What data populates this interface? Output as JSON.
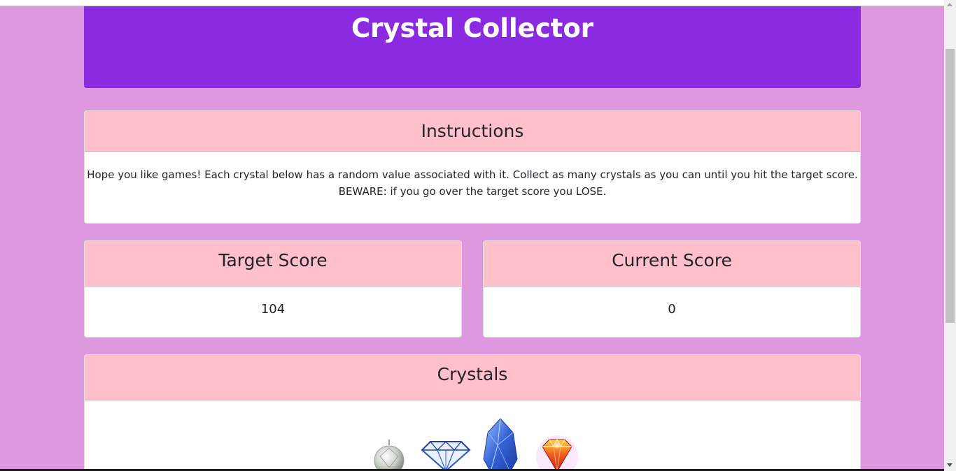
{
  "header": {
    "title": "Crystal Collector"
  },
  "instructions": {
    "title": "Instructions",
    "line1": "Hope you like games! Each crystal below has a random value associated with it. Collect as many crystals as you can until you hit the target score.",
    "line2": "BEWARE: if you go over the target score you LOSE."
  },
  "target": {
    "title": "Target Score",
    "value": "104"
  },
  "current": {
    "title": "Current Score",
    "value": "0"
  },
  "crystals": {
    "title": "Crystals",
    "items": [
      {
        "name": "clear-crystal-ball",
        "color": "#cfd6cf"
      },
      {
        "name": "diamond",
        "color": "#2f5fd0"
      },
      {
        "name": "blue-crystal",
        "color": "#2a52c8"
      },
      {
        "name": "rainbow-gem",
        "color": "#e0461a"
      }
    ]
  },
  "colors": {
    "background": "#dd98df",
    "jumbotron": "#8a2be2",
    "card_header": "#ffc0cb"
  }
}
